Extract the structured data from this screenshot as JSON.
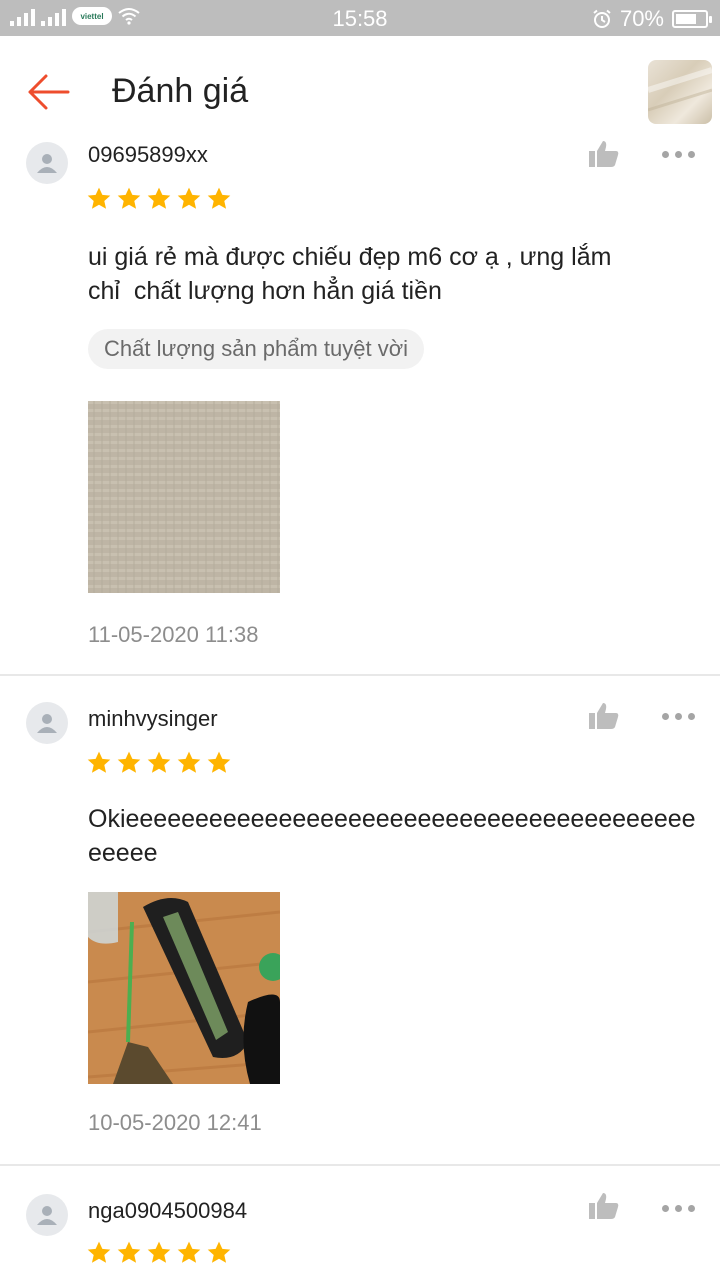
{
  "status_bar": {
    "time": "15:58",
    "battery": "70%",
    "battery_level": 0.7,
    "carrier": "viettel"
  },
  "header": {
    "title": "Đánh giá"
  },
  "reviews": [
    {
      "username": "09695899xx",
      "rating": 5,
      "text": "ui giá rẻ mà được chiếu đẹp m6 cơ ạ , ưng lắm\nchỉ  chất lượng hơn hẳn giá tiền",
      "tag": "Chất lượng sản phẩm tuyệt vời",
      "date": "11-05-2020 11:38"
    },
    {
      "username": "minhvysinger",
      "rating": 5,
      "text": "Okieeeeeeeeeeeeeeeeeeeeeeeeeeeeeeeeeeeeeeeeeeeeee",
      "date": "10-05-2020 12:41"
    },
    {
      "username": "nga0904500984",
      "rating": 5
    }
  ],
  "colors": {
    "accent": "#ee4d2d",
    "star": "#ffb400",
    "status_bar": "#bdbdbd"
  },
  "icons": {
    "back": "back-arrow-icon",
    "like": "thumbs-up-icon",
    "more": "more-dots-icon",
    "avatar": "user-icon",
    "star": "star-icon"
  }
}
